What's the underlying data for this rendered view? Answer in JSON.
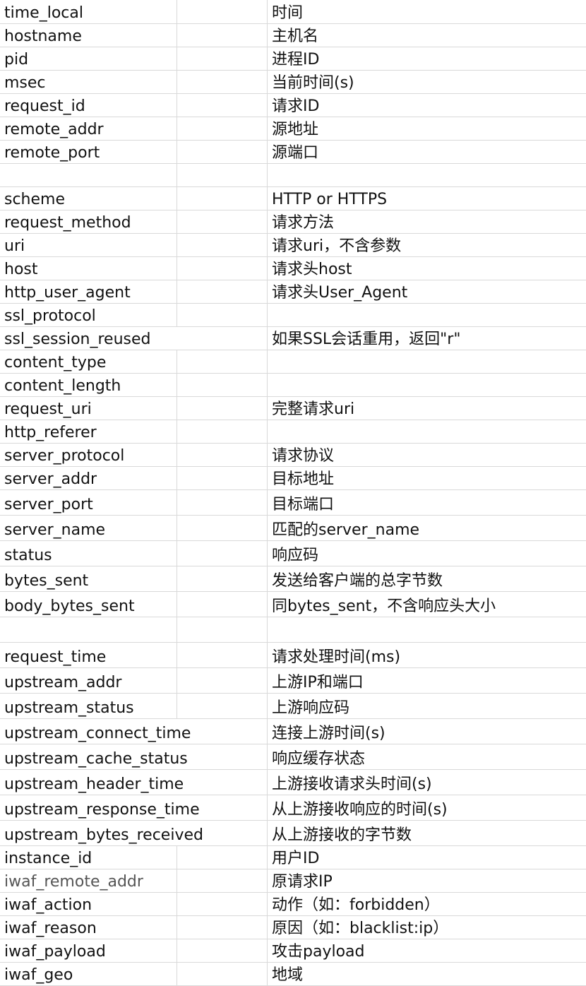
{
  "rows": [
    {
      "field": "time_local",
      "desc": "时间"
    },
    {
      "field": "hostname",
      "desc": "主机名"
    },
    {
      "field": "pid",
      "desc": "进程ID"
    },
    {
      "field": "msec",
      "desc": "当前时间(s)"
    },
    {
      "field": "request_id",
      "desc": "请求ID"
    },
    {
      "field": "remote_addr",
      "desc": "源地址"
    },
    {
      "field": "remote_port",
      "desc": "源端口"
    },
    {
      "field": "",
      "desc": ""
    },
    {
      "field": "scheme",
      "desc": "HTTP or HTTPS"
    },
    {
      "field": "request_method",
      "desc": "请求方法"
    },
    {
      "field": "uri",
      "desc": "请求uri，不含参数"
    },
    {
      "field": "host",
      "desc": "请求头host"
    },
    {
      "field": "http_user_agent",
      "desc": "请求头User_Agent"
    },
    {
      "field": "ssl_protocol",
      "desc": ""
    },
    {
      "field": "ssl_session_reused",
      "desc": "如果SSL会话重用，返回\"r\""
    },
    {
      "field": "content_type",
      "desc": ""
    },
    {
      "field": "content_length",
      "desc": ""
    },
    {
      "field": "request_uri",
      "desc": "完整请求uri"
    },
    {
      "field": "http_referer",
      "desc": ""
    },
    {
      "field": "server_protocol",
      "desc": "请求协议"
    },
    {
      "field": "server_addr",
      "desc": "目标地址"
    },
    {
      "field": "server_port",
      "desc": "目标端口"
    },
    {
      "field": "server_name",
      "desc": "匹配的server_name"
    },
    {
      "field": "status",
      "desc": "响应码"
    },
    {
      "field": "bytes_sent",
      "desc": "发送给客户端的总字节数"
    },
    {
      "field": "body_bytes_sent",
      "desc": "同bytes_sent，不含响应头大小"
    },
    {
      "field": "",
      "desc": ""
    },
    {
      "field": "request_time",
      "desc": "请求处理时间(ms)"
    },
    {
      "field": "upstream_addr",
      "desc": "上游IP和端口"
    },
    {
      "field": "upstream_status",
      "desc": "上游响应码"
    },
    {
      "field": "upstream_connect_time",
      "desc": "连接上游时间(s)"
    },
    {
      "field": "upstream_cache_status",
      "desc": "响应缓存状态"
    },
    {
      "field": "upstream_header_time",
      "desc": "上游接收请求头时间(s)"
    },
    {
      "field": "upstream_response_time",
      "desc": "从上游接收响应的时间(s)"
    },
    {
      "field": "upstream_bytes_received",
      "desc": "从上游接收的字节数"
    },
    {
      "field": "instance_id",
      "desc": "用户ID"
    },
    {
      "field": "iwaf_remote_addr",
      "desc": "原请求IP"
    },
    {
      "field": "iwaf_action",
      "desc": "动作（如：forbidden）"
    },
    {
      "field": "iwaf_reason",
      "desc": "原因（如：blacklist:ip）"
    },
    {
      "field": "iwaf_payload",
      "desc": "攻击payload"
    },
    {
      "field": "iwaf_geo",
      "desc": "地域"
    }
  ]
}
